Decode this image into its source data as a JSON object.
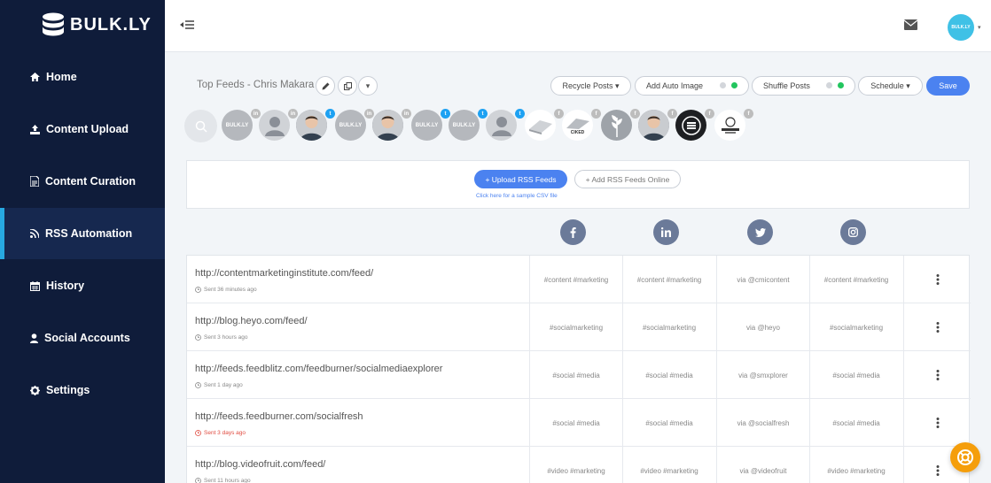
{
  "brand": {
    "name": "BULK.LY"
  },
  "sidebar": {
    "items": [
      {
        "label": "Home",
        "icon": "home-icon"
      },
      {
        "label": "Content Upload",
        "icon": "upload-icon"
      },
      {
        "label": "Content Curation",
        "icon": "document-icon"
      },
      {
        "label": "RSS Automation",
        "icon": "rss-icon",
        "active": true
      },
      {
        "label": "History",
        "icon": "calendar-icon"
      },
      {
        "label": "Social Accounts",
        "icon": "user-icon"
      },
      {
        "label": "Settings",
        "icon": "gear-icon"
      }
    ]
  },
  "topbar": {
    "avatar_text": "BULK.LY",
    "caret": "▾"
  },
  "header": {
    "title": "Top Feeds - Chris Makara",
    "recycle_label": "Recycle Posts ▾",
    "auto_image_label": "Add Auto Image",
    "shuffle_label": "Shuffle Posts",
    "schedule_label": "Schedule ▾",
    "save_label": "Save",
    "caret": "▾"
  },
  "accounts": [
    {
      "type": "search"
    },
    {
      "type": "bulkly",
      "network": "in"
    },
    {
      "type": "person",
      "network": "in"
    },
    {
      "type": "photo",
      "network": "tw"
    },
    {
      "type": "bulkly",
      "network": "in"
    },
    {
      "type": "photo",
      "network": "in"
    },
    {
      "type": "bulkly",
      "network": "tw"
    },
    {
      "type": "bulkly",
      "network": "tw"
    },
    {
      "type": "person",
      "network": "tw"
    },
    {
      "type": "logo",
      "network": "f"
    },
    {
      "type": "ciked",
      "network": "f",
      "text": "CIKED"
    },
    {
      "type": "plant",
      "network": "f"
    },
    {
      "type": "photo",
      "network": "f"
    },
    {
      "type": "dark",
      "network": "f"
    },
    {
      "type": "lanyard",
      "network": "f"
    }
  ],
  "upload": {
    "upload_label": "+ Upload RSS Feeds",
    "add_label": "+ Add RSS Feeds Online",
    "sample_link": "Click here for a sample CSV file"
  },
  "columns": [
    "facebook-icon",
    "linkedin-icon",
    "twitter-icon",
    "instagram-icon"
  ],
  "colors": {
    "sidebar": "#0f1c3a",
    "accent": "#4b82f0",
    "active_bar": "#27a9e1",
    "toggle_on": "#22c55e",
    "fab": "#f59e0b"
  },
  "feeds": [
    {
      "url": "http://contentmarketinginstitute.com/feed/",
      "sent": "Sent 36 minutes ago",
      "sent_red": false,
      "fb": "#content #marketing",
      "li": "#content #marketing",
      "tw": "via @cmicontent",
      "ig": "#content #marketing"
    },
    {
      "url": "http://blog.heyo.com/feed/",
      "sent": "Sent 3 hours ago",
      "sent_red": false,
      "fb": "#socialmarketing",
      "li": "#socialmarketing",
      "tw": "via @heyo",
      "ig": "#socialmarketing"
    },
    {
      "url": "http://feeds.feedblitz.com/feedburner/socialmediaexplorer",
      "sent": "Sent 1 day ago",
      "sent_red": false,
      "fb": "#social #media",
      "li": "#social #media",
      "tw": "via @smxplorer",
      "ig": "#social #media"
    },
    {
      "url": "http://feeds.feedburner.com/socialfresh",
      "sent": "Sent 3 days ago",
      "sent_red": true,
      "fb": "#social #media",
      "li": "#social #media",
      "tw": "via @socialfresh",
      "ig": "#social #media"
    },
    {
      "url": "http://blog.videofruit.com/feed/",
      "sent": "Sent 11 hours ago",
      "sent_red": false,
      "fb": "#video #marketing",
      "li": "#video #marketing",
      "tw": "via @videofruit",
      "ig": "#video #marketing"
    }
  ]
}
